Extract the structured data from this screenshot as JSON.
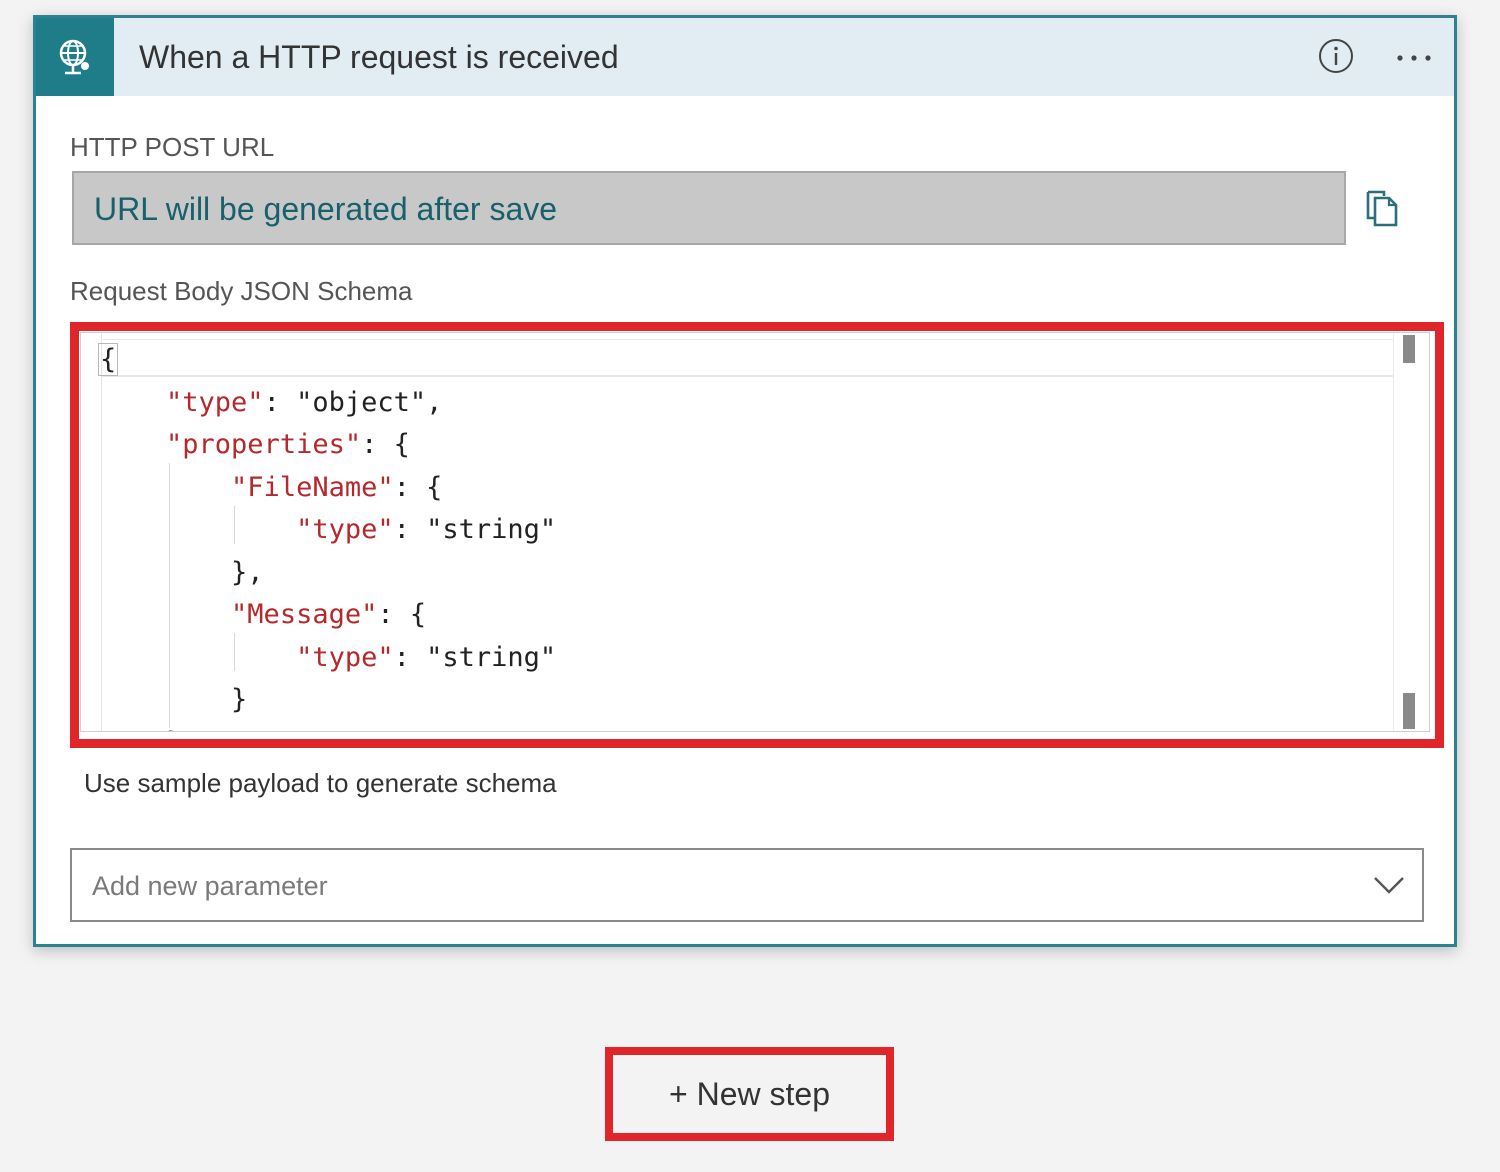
{
  "trigger": {
    "icon": "http-request-globe-icon",
    "title": "When a HTTP request is received",
    "info_icon": "info-icon",
    "more_icon": "more-options-icon"
  },
  "url_field": {
    "label": "HTTP POST URL",
    "value": "URL will be generated after save",
    "copy_icon": "copy-icon"
  },
  "schema_field": {
    "label": "Request Body JSON Schema",
    "code_lines": [
      "{",
      "    \"type\": \"object\",",
      "    \"properties\": {",
      "        \"FileName\": {",
      "            \"type\": \"string\"",
      "        },",
      "        \"Message\": {",
      "            \"type\": \"string\"",
      "        }",
      "    }"
    ]
  },
  "sample_payload_link": "Use sample payload to generate schema",
  "add_parameter": {
    "placeholder": "Add new parameter",
    "chevron_icon": "chevron-down-icon"
  },
  "new_step": {
    "label": "+ New step"
  },
  "colors": {
    "accent": "#1e7d88",
    "header_bg": "#e1edf2",
    "highlight": "#e0252b",
    "json_key": "#b5282c"
  }
}
